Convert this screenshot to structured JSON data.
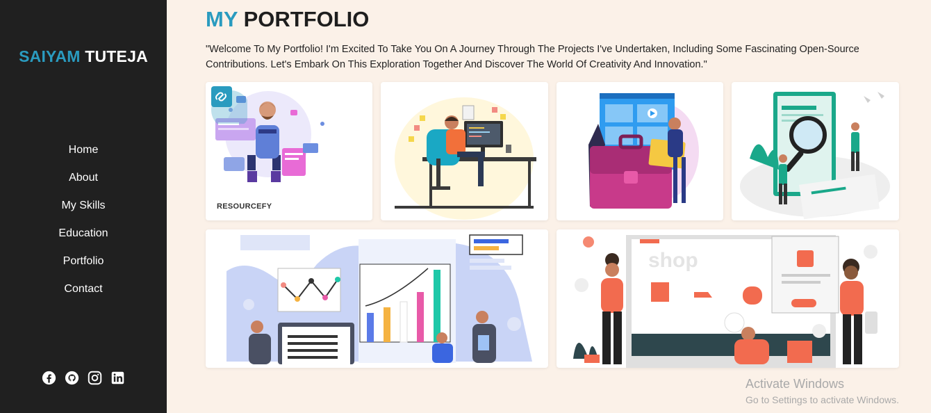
{
  "sidebar": {
    "brand_first": "SAIYAM",
    "brand_last": "TUTEJA",
    "nav": [
      "Home",
      "About",
      "My Skills",
      "Education",
      "Portfolio",
      "Contact"
    ],
    "socials": [
      "facebook-icon",
      "github-icon",
      "instagram-icon",
      "linkedin-icon"
    ]
  },
  "main": {
    "title_accent": "MY",
    "title_rest": "PORTFOLIO",
    "intro": "\"Welcome To My Portfolio! I'm Excited To Take You On A Journey Through The Projects I've Undertaken, Including Some Fascinating Open-Source Contributions. Let's Embark On This Exploration Together And Discover The World Of Creativity And Innovation.\"",
    "projects": [
      {
        "label": "RESOURCEFY",
        "icon": "link-icon"
      },
      {
        "label": ""
      },
      {
        "label": ""
      },
      {
        "label": ""
      },
      {
        "label": ""
      },
      {
        "label": ""
      }
    ]
  },
  "colors": {
    "accent": "#2a9bbf",
    "sidebar_bg": "#202020",
    "page_bg": "#fbf1e8"
  },
  "watermark": {
    "line1": "Activate Windows",
    "line2": "Go to Settings to activate Windows."
  }
}
